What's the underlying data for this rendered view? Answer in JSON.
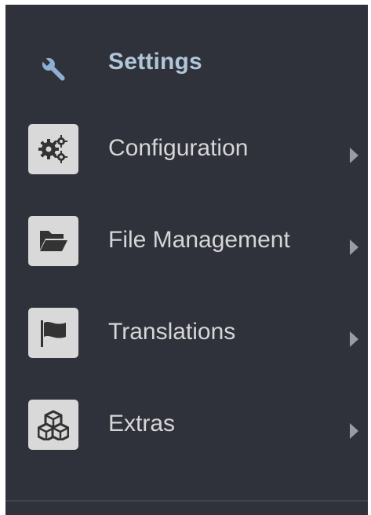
{
  "menu": {
    "header": {
      "title": "Settings",
      "icon": "wrench-icon"
    },
    "items": [
      {
        "label": "Configuration",
        "icon": "gears-icon"
      },
      {
        "label": "File Management",
        "icon": "folder-open-icon"
      },
      {
        "label": "Translations",
        "icon": "flag-icon"
      },
      {
        "label": "Extras",
        "icon": "cubes-icon"
      }
    ]
  },
  "colors": {
    "panel_bg": "#2f313b",
    "title": "#b0c7da",
    "label": "#d6d6d6",
    "tile_bg": "#d9d9d9",
    "caret": "#9a9ca3"
  }
}
